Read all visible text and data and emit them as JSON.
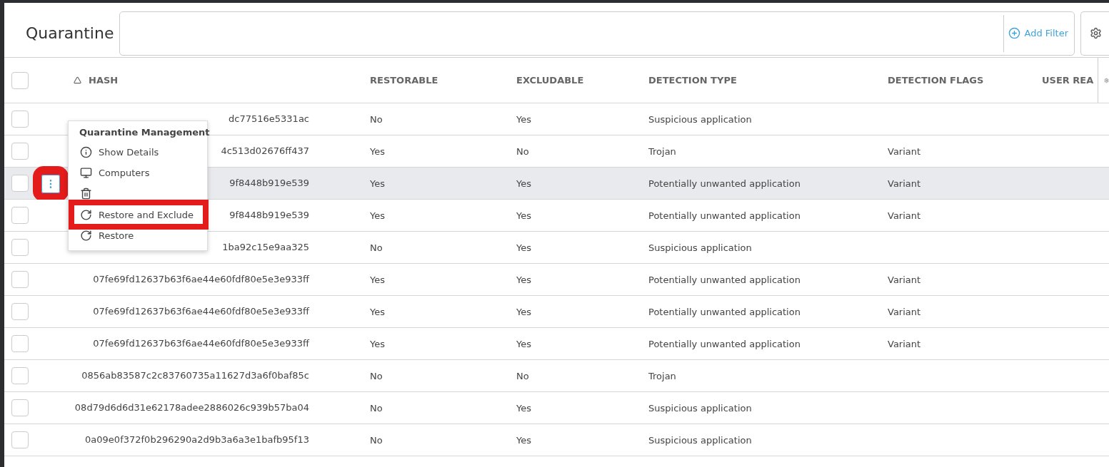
{
  "page": {
    "title": "Quarantine"
  },
  "filter_bar": {
    "add_filter": "Add Filter"
  },
  "table": {
    "select_all_checked": false,
    "columns": [
      {
        "label": "HASH",
        "sorted": true
      },
      {
        "label": "RESTORABLE",
        "sorted": false
      },
      {
        "label": "EXCLUDABLE",
        "sorted": false
      },
      {
        "label": "DETECTION TYPE",
        "sorted": false
      },
      {
        "label": "DETECTION FLAGS",
        "sorted": false
      },
      {
        "label": "USER REA",
        "sorted": false
      }
    ],
    "rows": [
      {
        "hash": "dc77516e5331ac",
        "restorable": "No",
        "excludable": "Yes",
        "detection_type": "Suspicious application",
        "detection_flags": "",
        "selected": false,
        "checked": false
      },
      {
        "hash": "4c513d02676ff437",
        "restorable": "Yes",
        "excludable": "No",
        "detection_type": "Trojan",
        "detection_flags": "Variant",
        "selected": false,
        "checked": false
      },
      {
        "hash": "9f8448b919e539",
        "restorable": "Yes",
        "excludable": "Yes",
        "detection_type": "Potentially unwanted application",
        "detection_flags": "Variant",
        "selected": true,
        "checked": false
      },
      {
        "hash": "9f8448b919e539",
        "restorable": "Yes",
        "excludable": "Yes",
        "detection_type": "Potentially unwanted application",
        "detection_flags": "Variant",
        "selected": false,
        "checked": false
      },
      {
        "hash": "1ba92c15e9aa325",
        "restorable": "No",
        "excludable": "Yes",
        "detection_type": "Suspicious application",
        "detection_flags": "",
        "selected": false,
        "checked": false
      },
      {
        "hash": "07fe69fd12637b63f6ae44e60fdf80e5e3e933ff",
        "restorable": "Yes",
        "excludable": "Yes",
        "detection_type": "Potentially unwanted application",
        "detection_flags": "Variant",
        "selected": false,
        "checked": false
      },
      {
        "hash": "07fe69fd12637b63f6ae44e60fdf80e5e3e933ff",
        "restorable": "Yes",
        "excludable": "Yes",
        "detection_type": "Potentially unwanted application",
        "detection_flags": "Variant",
        "selected": false,
        "checked": false
      },
      {
        "hash": "07fe69fd12637b63f6ae44e60fdf80e5e3e933ff",
        "restorable": "Yes",
        "excludable": "Yes",
        "detection_type": "Potentially unwanted application",
        "detection_flags": "Variant",
        "selected": false,
        "checked": false
      },
      {
        "hash": "0856ab83587c2c83760735a11627d3a6f0baf85c",
        "restorable": "No",
        "excludable": "No",
        "detection_type": "Trojan",
        "detection_flags": "",
        "selected": false,
        "checked": false
      },
      {
        "hash": "08d79d6d6d31e62178adee2886026c939b57ba04",
        "restorable": "No",
        "excludable": "Yes",
        "detection_type": "Suspicious application",
        "detection_flags": "",
        "selected": false,
        "checked": false
      },
      {
        "hash": "0a09e0f372f0b296290a2d9b3a6a3e1bafb95f13",
        "restorable": "No",
        "excludable": "Yes",
        "detection_type": "Suspicious application",
        "detection_flags": "",
        "selected": false,
        "checked": false
      }
    ]
  },
  "context_menu": {
    "title": "Quarantine Management",
    "items": [
      {
        "kind": "info",
        "label": "Show Details",
        "highlighted": false
      },
      {
        "kind": "computer",
        "label": "Computers",
        "highlighted": false
      },
      {
        "kind": "trash",
        "highlighted": false
      },
      {
        "kind": "restore",
        "label": "Restore and Exclude",
        "highlighted": true
      },
      {
        "kind": "restore",
        "label": "Restore",
        "highlighted": false
      }
    ]
  }
}
